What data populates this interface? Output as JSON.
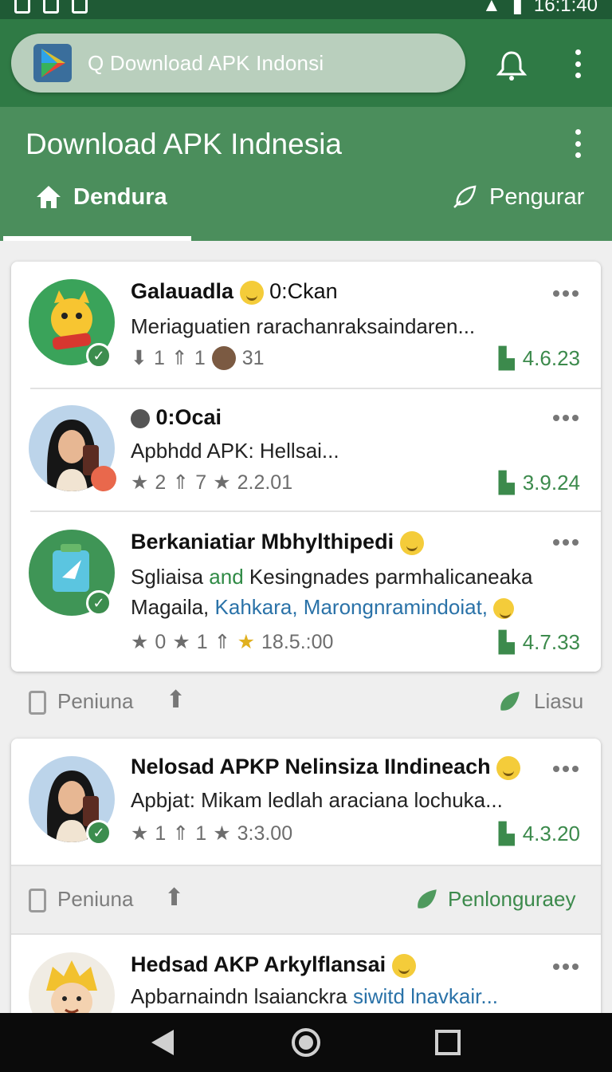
{
  "status_bar": {
    "time": "16:1:40"
  },
  "search": {
    "text": "Q Download APK Indonsi"
  },
  "page": {
    "title": "Download APK Indnesia"
  },
  "tabs": [
    {
      "label": "Dendura",
      "icon": "home-icon",
      "active": true
    },
    {
      "label": "Pengurar",
      "icon": "leaf-tag-icon",
      "active": false
    }
  ],
  "apps": [
    {
      "name": "Galauadla",
      "name_suffix": "0:Ckan",
      "desc": "Meriaguatien rarachanraksaindaren...",
      "meta_a": "1",
      "meta_b": "1",
      "meta_c": "31",
      "rating": "4.6.23"
    },
    {
      "name": "0:Ocai",
      "desc": "Apbhdd APK: Hellsai...",
      "meta_a": "2",
      "meta_b": "7",
      "meta_c": "2.2.01",
      "rating": "3.9.24"
    },
    {
      "name": "Berkaniatiar Mbhylthipedi",
      "desc_line1_a": "Sgliaisa",
      "desc_line1_and": "and",
      "desc_line1_b": "Kesingnades parmhalicaneaka",
      "desc_line2_a": "Magaila,",
      "desc_line2_links": "Kahkara, Marongnramindoiat,",
      "meta_a": "0",
      "meta_b": "1",
      "meta_c": "18.5.:00",
      "rating": "4.7.33"
    },
    {
      "name": "Nelosad APKP Nelinsiza IIndineach",
      "desc": "Apbjat: Mikam ledlah araciana lochuka...",
      "meta_a": "1",
      "meta_b": "1",
      "meta_c": "3:3.00",
      "rating": "4.3.20"
    },
    {
      "name": "Hedsad AKP Arkylflansai",
      "desc_a": "Apbarnaindn lsaianckra",
      "desc_link": "siwitd lnavkair...",
      "rating": ""
    }
  ],
  "action_rows": [
    {
      "left_label": "Peniuna",
      "right_label": "Liasu"
    },
    {
      "left_label": "Peniuna",
      "right_label": "Penlonguraey"
    }
  ],
  "colors": {
    "primary": "#2f7a45",
    "header": "#4b8e5c",
    "rating_green": "#3c8a4c",
    "link_blue": "#2a72a8"
  }
}
